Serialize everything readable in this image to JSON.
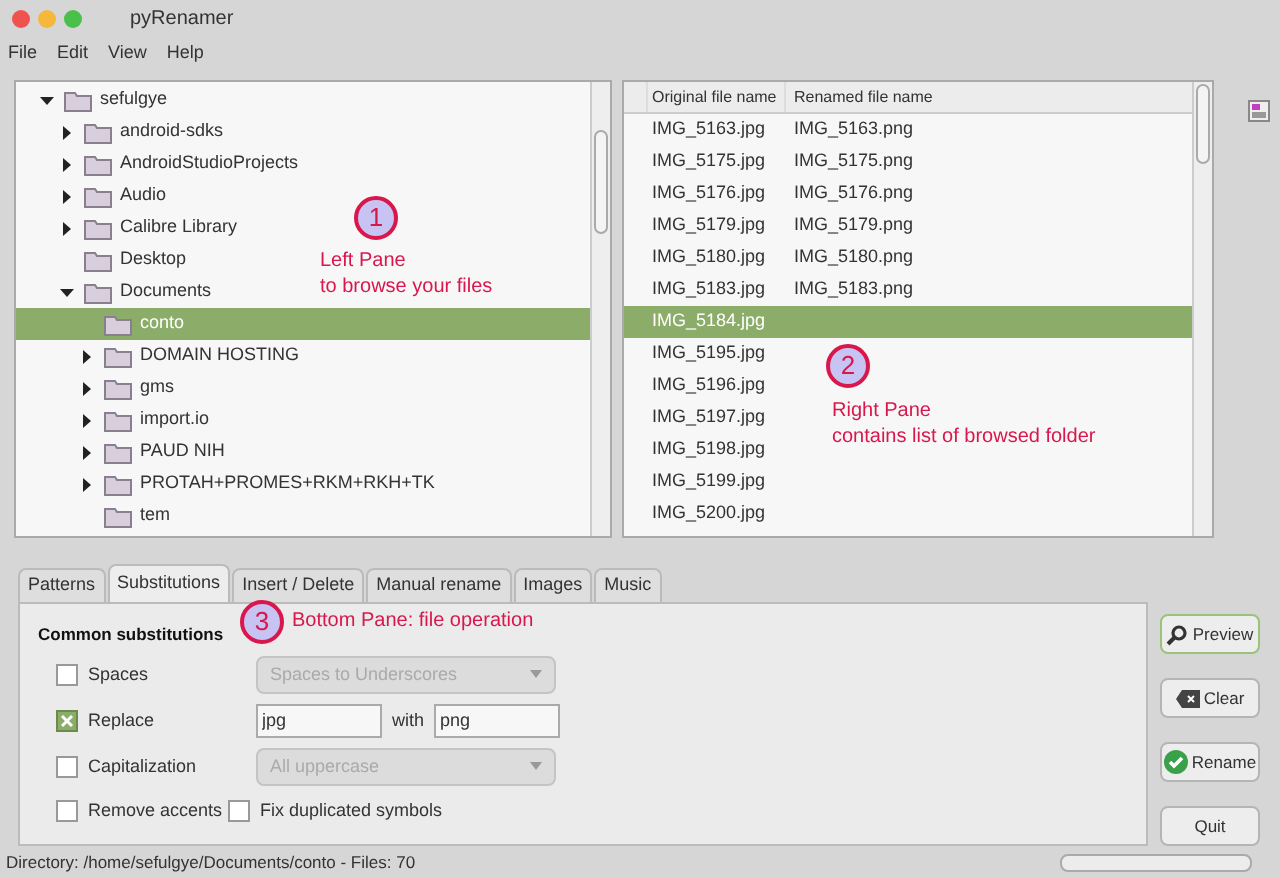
{
  "window": {
    "title": "pyRenamer"
  },
  "menu": [
    "File",
    "Edit",
    "View",
    "Help"
  ],
  "tree": [
    {
      "label": "sefulgye",
      "expanded": true,
      "selected": false,
      "children": [
        {
          "label": "android-sdks",
          "expanded": false,
          "selected": false
        },
        {
          "label": "AndroidStudioProjects",
          "expanded": false,
          "selected": false
        },
        {
          "label": "Audio",
          "expanded": false,
          "selected": false
        },
        {
          "label": "Calibre Library",
          "expanded": false,
          "selected": false
        },
        {
          "label": "Desktop",
          "selected": false
        },
        {
          "label": "Documents",
          "expanded": true,
          "selected": false,
          "children": [
            {
              "label": "conto",
              "selected": true
            },
            {
              "label": "DOMAIN HOSTING",
              "expanded": false,
              "selected": false
            },
            {
              "label": "gms",
              "expanded": false,
              "selected": false
            },
            {
              "label": "import.io",
              "expanded": false,
              "selected": false
            },
            {
              "label": "PAUD NIH",
              "expanded": false,
              "selected": false
            },
            {
              "label": "PROTAH+PROMES+RKM+RKH+TK",
              "expanded": false,
              "selected": false
            },
            {
              "label": "tem",
              "selected": false
            }
          ]
        }
      ]
    }
  ],
  "file_table": {
    "columns": [
      "Original file name",
      "Renamed file name"
    ],
    "rows": [
      {
        "original": "IMG_5163.jpg",
        "renamed": "IMG_5163.png",
        "selected": false
      },
      {
        "original": "IMG_5175.jpg",
        "renamed": "IMG_5175.png",
        "selected": false
      },
      {
        "original": "IMG_5176.jpg",
        "renamed": "IMG_5176.png",
        "selected": false
      },
      {
        "original": "IMG_5179.jpg",
        "renamed": "IMG_5179.png",
        "selected": false
      },
      {
        "original": "IMG_5180.jpg",
        "renamed": "IMG_5180.png",
        "selected": false
      },
      {
        "original": "IMG_5183.jpg",
        "renamed": "IMG_5183.png",
        "selected": false
      },
      {
        "original": "IMG_5184.jpg",
        "selected": true
      },
      {
        "original": "IMG_5195.jpg",
        "selected": false
      },
      {
        "original": "IMG_5196.jpg",
        "selected": false
      },
      {
        "original": "IMG_5197.jpg",
        "selected": false
      },
      {
        "original": "IMG_5198.jpg",
        "selected": false
      },
      {
        "original": "IMG_5199.jpg",
        "selected": false
      },
      {
        "original": "IMG_5200.jpg",
        "selected": false
      }
    ]
  },
  "tabs": [
    {
      "label": "Patterns",
      "selected": false
    },
    {
      "label": "Substitutions",
      "selected": true
    },
    {
      "label": "Insert / Delete",
      "selected": false
    },
    {
      "label": "Manual rename",
      "selected": false
    },
    {
      "label": "Images",
      "selected": false
    },
    {
      "label": "Music",
      "selected": false
    }
  ],
  "substitutions": {
    "heading": "Common substitutions",
    "spaces": {
      "label": "Spaces",
      "checked": false,
      "value": "Spaces to Underscores"
    },
    "replace": {
      "label": "Replace",
      "checked": true,
      "from": "jpg",
      "with_label": "with",
      "to": "png"
    },
    "capitalization": {
      "label": "Capitalization",
      "checked": false,
      "value": "All uppercase"
    },
    "remove_accents": {
      "label": "Remove accents",
      "checked": false
    },
    "fix_duplicated": {
      "label": "Fix duplicated symbols",
      "checked": false
    }
  },
  "buttons": [
    {
      "kind": "preview",
      "label": "Preview"
    },
    {
      "kind": "clear",
      "label": "Clear"
    },
    {
      "kind": "rename",
      "label": "Rename"
    },
    {
      "kind": "quit",
      "label": "Quit"
    }
  ],
  "status_bar": {
    "text": "Directory: /home/sefulgye/Documents/conto - Files: 70",
    "level": 0
  },
  "callouts": [
    {
      "number": "1",
      "lines": [
        "Left Pane",
        "to browse your files"
      ]
    },
    {
      "number": "2",
      "lines": [
        "Right Pane",
        "contains list of browsed folder"
      ]
    },
    {
      "number": "3",
      "lines": [
        "Bottom Pane: file operation"
      ]
    }
  ]
}
